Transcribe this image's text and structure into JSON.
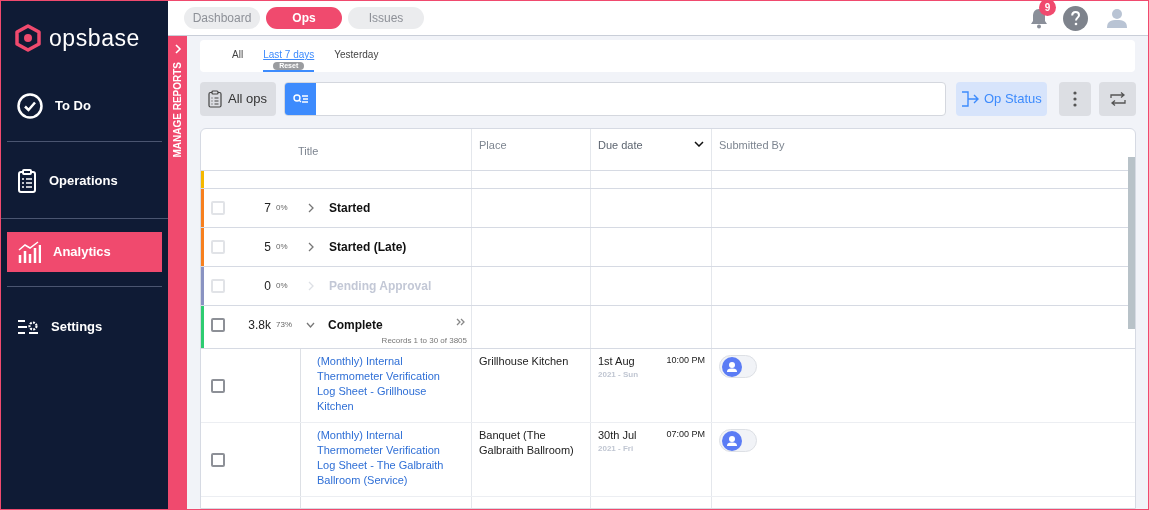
{
  "brand": {
    "name": "opsbase"
  },
  "nav": [
    {
      "label": "To Do",
      "selected": false
    },
    {
      "label": "Operations",
      "selected": false
    },
    {
      "label": "Analytics",
      "selected": true
    },
    {
      "label": "Settings",
      "selected": false
    }
  ],
  "side_panel": {
    "label": "MANAGE REPORTS"
  },
  "top_tabs": [
    {
      "label": "Dashboard",
      "selected": false
    },
    {
      "label": "Ops",
      "selected": true
    },
    {
      "label": "Issues",
      "selected": false
    }
  ],
  "notifications": {
    "count": "9"
  },
  "date_filters": [
    {
      "label": "All",
      "selected": false
    },
    {
      "label": "Last 7 days",
      "selected": true,
      "badge": "Reset"
    },
    {
      "label": "Yesterday",
      "selected": false
    }
  ],
  "toolbar": {
    "all_ops": "All ops",
    "op_status": "Op Status"
  },
  "table": {
    "columns": [
      {
        "label": "Title",
        "sorted": false
      },
      {
        "label": "Place",
        "sorted": false
      },
      {
        "label": "Due date",
        "sorted": true
      },
      {
        "label": "Submitted By",
        "sorted": false
      }
    ],
    "clipped_group": {
      "color": "#f5b800"
    },
    "groups": [
      {
        "count": "7",
        "percent": "0%",
        "label": "Started",
        "color": "#f7801e",
        "expanded": false,
        "disabled": false,
        "checked": false
      },
      {
        "count": "5",
        "percent": "0%",
        "label": "Started (Late)",
        "color": "#f7801e",
        "expanded": false,
        "disabled": false,
        "checked": false
      },
      {
        "count": "0",
        "percent": "0%",
        "label": "Pending Approval",
        "color": "#8a93c2",
        "expanded": false,
        "disabled": true,
        "checked": false
      },
      {
        "count": "3.8k",
        "percent": "73%",
        "label": "Complete",
        "color": "#2ecc71",
        "expanded": true,
        "disabled": false,
        "checked": false,
        "records": "Records 1 to 30 of 3805"
      }
    ],
    "rows": [
      {
        "title": "(Monthly) Internal Thermometer Verification Log Sheet - Grillhouse Kitchen",
        "place": "Grillhouse Kitchen",
        "date": "1st Aug",
        "year_day": "2021 - Sun",
        "time": "10:00 PM",
        "checked": false
      },
      {
        "title": "(Monthly) Internal Thermometer Verification Log Sheet - The Galbraith Ballroom (Service)",
        "place": "Banquet (The Galbraith Ballroom)",
        "date": "30th Jul",
        "year_day": "2021 - Fri",
        "time": "07:00 PM",
        "checked": false
      }
    ]
  }
}
